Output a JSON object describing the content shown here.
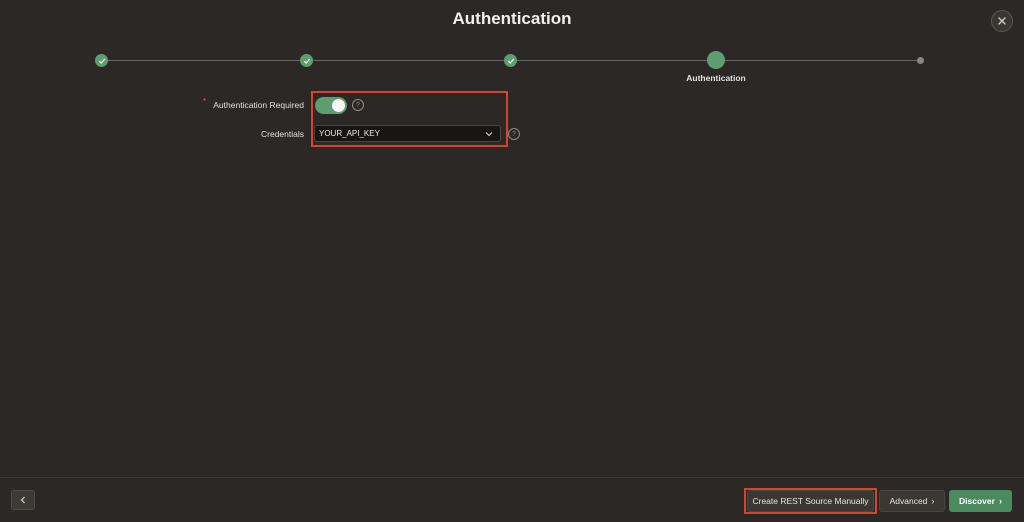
{
  "dialog": {
    "title": "Authentication"
  },
  "progress": {
    "steps_completed": 3,
    "current_step_label": "Authentication",
    "steps_remaining": 1
  },
  "form": {
    "auth_required": {
      "label": "Authentication Required",
      "required_marker": "*",
      "value": true,
      "help": "?"
    },
    "credentials": {
      "label": "Credentials",
      "value": "YOUR_API_KEY",
      "help": "?"
    }
  },
  "footer": {
    "create_manually_label": "Create REST Source Manually",
    "advanced_label": "Advanced",
    "discover_label": "Discover",
    "chevron": "›"
  },
  "colors": {
    "background": "#2b2825",
    "accent_green": "#5e9c72",
    "primary_button": "#4b8a5e",
    "highlight_red": "#d6442b"
  },
  "icons": {
    "close": "close-icon",
    "check": "check-icon",
    "chevron_down": "chevron-down-icon",
    "chevron_left": "chevron-left-icon",
    "help": "help-icon"
  }
}
